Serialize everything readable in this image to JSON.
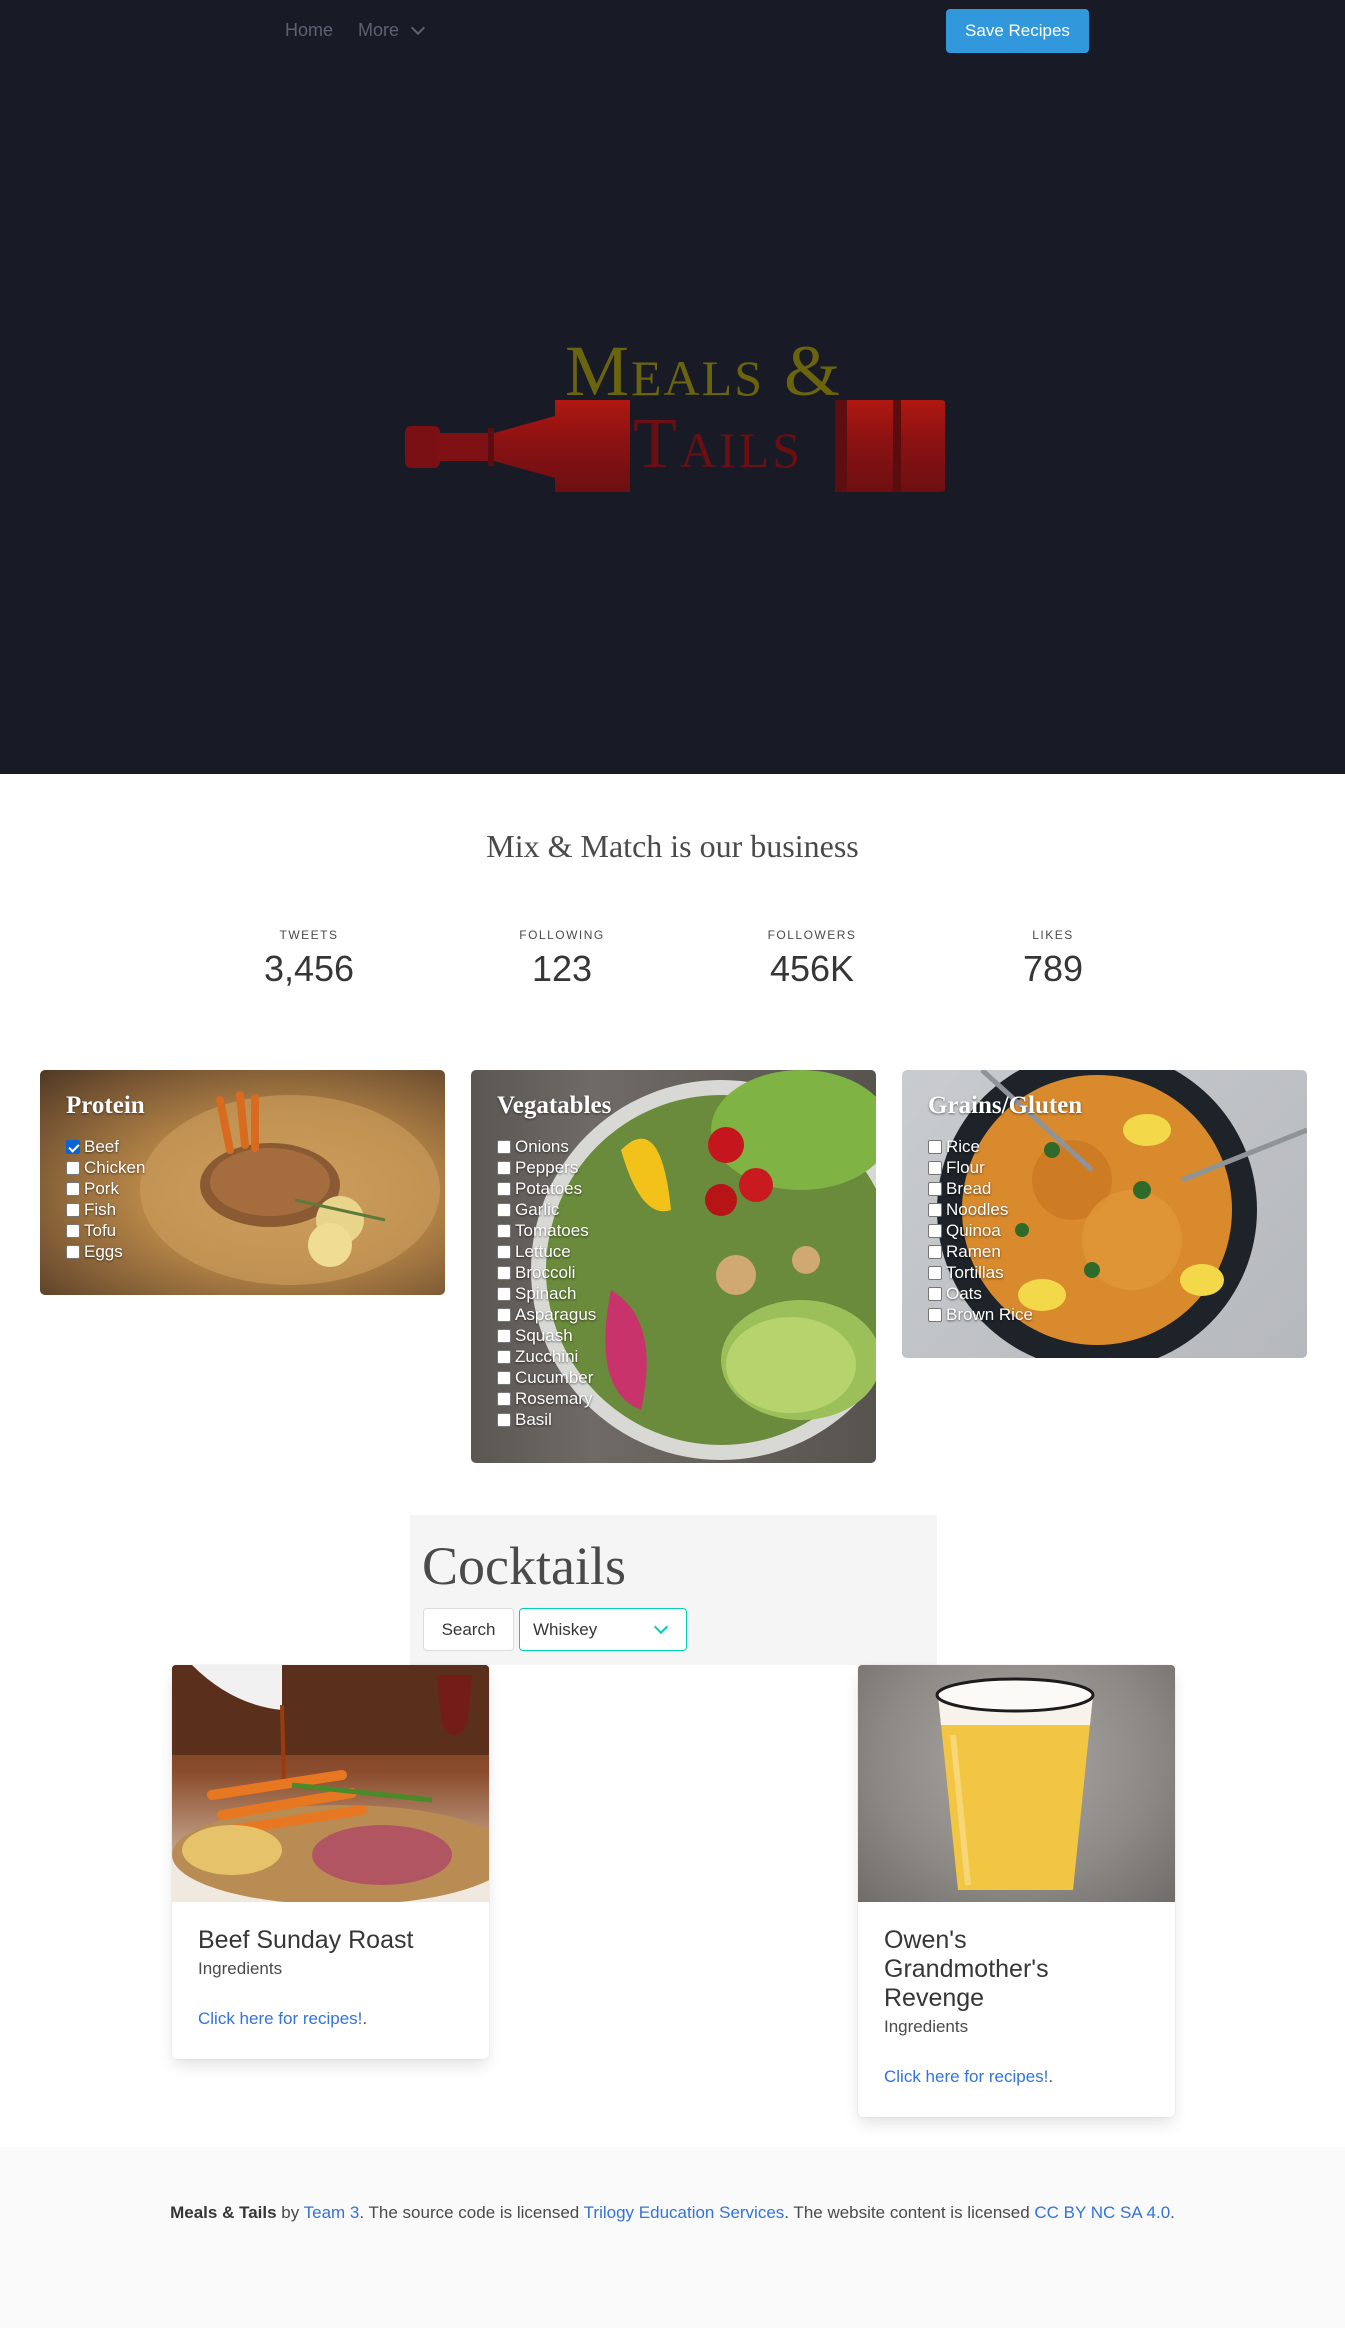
{
  "nav": {
    "home_label": "Home",
    "more_label": "More",
    "save_button_label": "Save Recipes"
  },
  "hero": {
    "logo_line1": "Meals &",
    "logo_line2": "Tails"
  },
  "tagline": "Mix & Match is our business",
  "stats": [
    {
      "label": "TWEETS",
      "value": "3,456"
    },
    {
      "label": "FOLLOWING",
      "value": "123"
    },
    {
      "label": "FOLLOWERS",
      "value": "456K"
    },
    {
      "label": "LIKES",
      "value": "789"
    }
  ],
  "ingredients": [
    {
      "title": "Protein",
      "items": [
        {
          "label": "Beef",
          "checked": true
        },
        {
          "label": "Chicken",
          "checked": false
        },
        {
          "label": "Pork",
          "checked": false
        },
        {
          "label": "Fish",
          "checked": false
        },
        {
          "label": "Tofu",
          "checked": false
        },
        {
          "label": "Eggs",
          "checked": false
        }
      ]
    },
    {
      "title": "Vegatables",
      "items": [
        {
          "label": "Onions",
          "checked": false
        },
        {
          "label": "Peppers",
          "checked": false
        },
        {
          "label": "Potatoes",
          "checked": false
        },
        {
          "label": "Garlic",
          "checked": false
        },
        {
          "label": "Tomatoes",
          "checked": false
        },
        {
          "label": "Lettuce",
          "checked": false
        },
        {
          "label": "Broccoli",
          "checked": false
        },
        {
          "label": "Spinach",
          "checked": false
        },
        {
          "label": "Asparagus",
          "checked": false
        },
        {
          "label": "Squash",
          "checked": false
        },
        {
          "label": "Zucchini",
          "checked": false
        },
        {
          "label": "Cucumber",
          "checked": false
        },
        {
          "label": "Rosemary",
          "checked": false
        },
        {
          "label": "Basil",
          "checked": false
        }
      ]
    },
    {
      "title": "Grains/Gluten",
      "items": [
        {
          "label": "Rice",
          "checked": false
        },
        {
          "label": "Flour",
          "checked": false
        },
        {
          "label": "Bread",
          "checked": false
        },
        {
          "label": "Noodles",
          "checked": false
        },
        {
          "label": "Quinoa",
          "checked": false
        },
        {
          "label": "Ramen",
          "checked": false
        },
        {
          "label": "Tortillas",
          "checked": false
        },
        {
          "label": "Oats",
          "checked": false
        },
        {
          "label": "Brown Rice",
          "checked": false
        }
      ]
    }
  ],
  "cocktails": {
    "title": "Cocktails",
    "search_label": "Search",
    "selected_spirit": "Whiskey"
  },
  "recipes": [
    {
      "title": "Beef Sunday Roast",
      "subtitle": "Ingredients",
      "link": "Click here for recipes!",
      "link_suffix": "."
    },
    {
      "title": "Owen's Grandmother's Revenge",
      "subtitle": "Ingredients",
      "link": "Click here for recipes!",
      "link_suffix": "."
    }
  ],
  "footer": {
    "brand": "Meals & Tails",
    "by": " by ",
    "team_link": "Team 3",
    "text1": ". The source code is licensed ",
    "source_link": "Trilogy Education Services",
    "text2": ". The website content is licensed ",
    "content_link": "CC BY NC SA 4.0",
    "text3": "."
  },
  "colors": {
    "hero_bg": "#181b26",
    "primary": "#3298dc",
    "link": "#3273dc",
    "accent": "#00d1b2"
  }
}
